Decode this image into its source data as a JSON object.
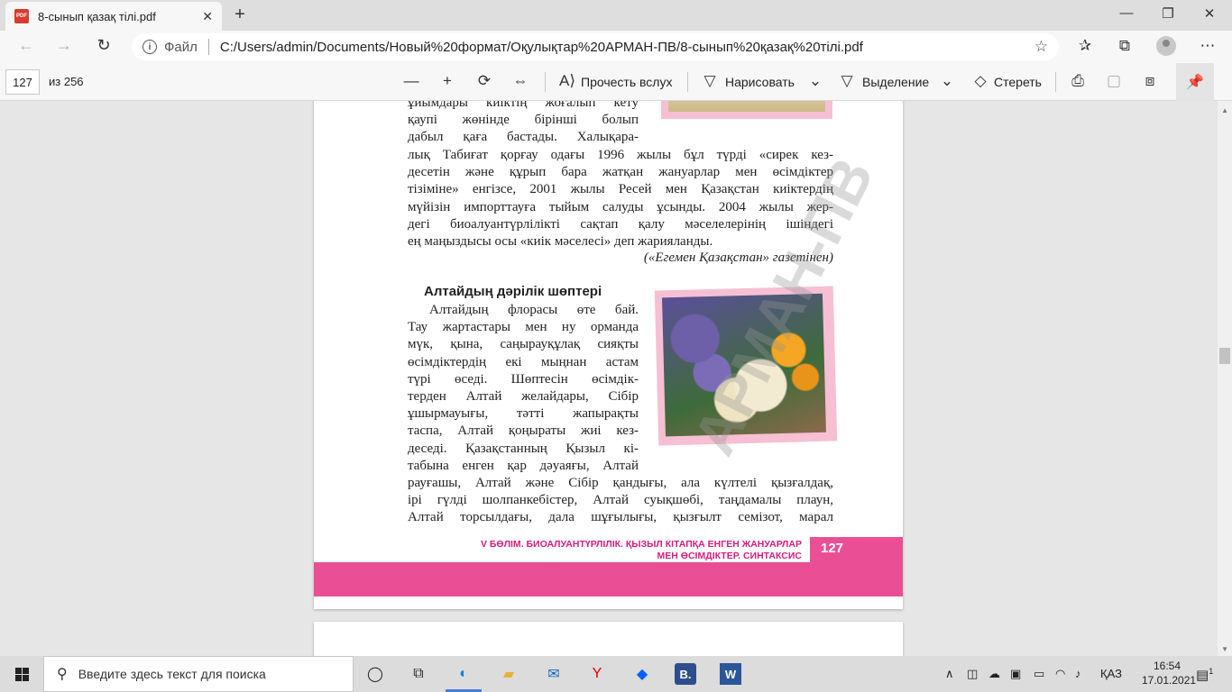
{
  "browser": {
    "tab_title": "8-сынып қазақ тілі.pdf",
    "pdf_badge": "PDF",
    "scheme_label": "Файл",
    "url": "C:/Users/admin/Documents/Новый%20формат/Оқулықтар%20АРМАН-ПВ/8-сынып%20қазақ%20тілі.pdf"
  },
  "pdf_toolbar": {
    "current_page": "127",
    "total_pages": "из 256",
    "read_aloud": "Прочесть вслух",
    "draw": "Нарисовать",
    "highlight": "Выделение",
    "erase": "Стереть"
  },
  "page": {
    "top_lines": [
      "ұйымдары киіктің жоғалып кету",
      "қаупі жөнінде бірінші болып",
      "дабыл қаға бастады. Халықара-"
    ],
    "mid_lines": [
      "лық Табиғат қорғау одағы 1996 жылы бұл түрді «сирек кез-",
      "десетін және құрып бара жатқан жануарлар мен өсімдіктер",
      "тізіміне» енгізсе, 2001 жылы Ресей мен Қазақстан киіктердің",
      "мүйізін импорттауға тыйым салуды ұсынды. 2004 жылы жер-",
      "дегі биоалуантүрлілікті сақтап қалу мәселелерінің ішіндегі"
    ],
    "mid_last_line": "ең маңыздысы осы «киік мәселесі» деп жарияланды.",
    "source": "(«Егемен Қазақстан» газетінен)",
    "heading": "Алтайдың дәрілік шөптері",
    "narrow_lines": [
      "Алтайдың флорасы өте бай.",
      "Тау жартастары мен ну орманда",
      "мүк, қына, саңырауқұлақ сияқты",
      "өсімдіктердің екі мыңнан астам",
      "түрі өседі. Шөптесін өсімдік-",
      "терден Алтай желайдары, Сібір",
      "ұшырмауығы, тәтті жапырақты",
      "таспа, Алтай қоңыраты жиі кез-",
      "деседі. Қазақстанның Қызыл кі-",
      "табына енген қар дәуаяғы, Алтай"
    ],
    "wide_lines": [
      "рауғашы, Алтай және Сібір қандығы, ала күлтелі қызғалдақ,",
      "ірі гүлді шолпанкебістер, Алтай суықшөбі, таңдамалы плаун,",
      "Алтай торсылдағы, дала шұғылығы, қызғылт семізот, марал"
    ],
    "footer_line1": "V БӨЛІМ. БИОАЛУАНТҮРЛІЛІК. ҚЫЗЫЛ КІТАПҚА ЕНГЕН ЖАНУАРЛАР",
    "footer_line2": "МЕН ӨСІМДІКТЕР. СИНТАКСИС",
    "page_number": "127",
    "watermark": "АРМАН-ПВ"
  },
  "taskbar": {
    "search_placeholder": "Введите здесь текст для поиска",
    "language": "ҚАЗ",
    "time": "16:54",
    "date": "17.01.2021",
    "notification_count": "1"
  },
  "colors": {
    "accent_pink": "#ea4f96",
    "heading_pink": "#d81b7a"
  }
}
